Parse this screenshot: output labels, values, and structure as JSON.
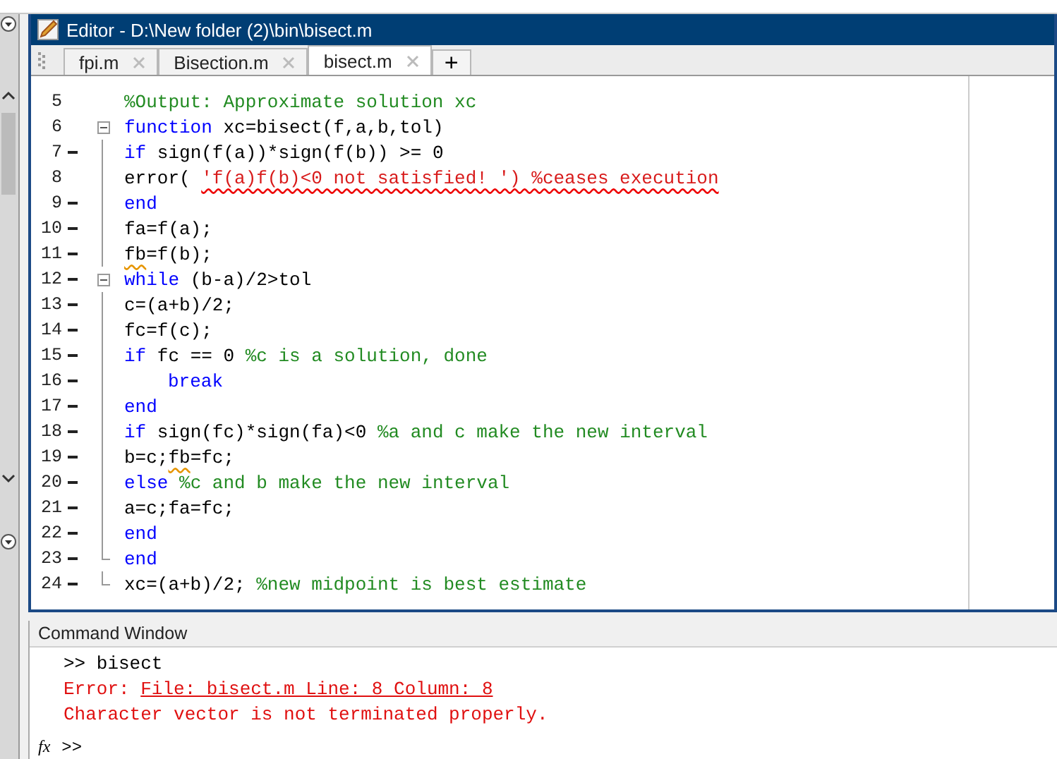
{
  "editor": {
    "title": "Editor - D:\\New folder (2)\\bin\\bisect.m",
    "tabs": [
      {
        "label": "fpi.m",
        "selected": false
      },
      {
        "label": "Bisection.m",
        "selected": false
      },
      {
        "label": "bisect.m",
        "selected": true
      }
    ],
    "new_tab": "+",
    "lines": [
      {
        "number": "5",
        "executable": false,
        "fold_start": false,
        "fold_end": false,
        "indented": false,
        "tokens": [
          {
            "text": "%Output: Approximate solution xc",
            "kind": "comment"
          }
        ]
      },
      {
        "number": "6",
        "executable": false,
        "fold_start": true,
        "fold_end": false,
        "indented": false,
        "tokens": [
          {
            "text": "function",
            "kind": "keyword"
          },
          {
            "text": " xc=bisect(f,a,b,tol)",
            "kind": "code"
          }
        ]
      },
      {
        "number": "7",
        "executable": true,
        "fold_start": false,
        "fold_end": false,
        "indented": false,
        "tokens": [
          {
            "text": "if",
            "kind": "keyword"
          },
          {
            "text": " sign(f(a))*sign(f(b)) >= 0",
            "kind": "code"
          }
        ]
      },
      {
        "number": "8",
        "executable": false,
        "fold_start": false,
        "fold_end": false,
        "indented": false,
        "tokens": [
          {
            "text": "error( ",
            "kind": "code"
          },
          {
            "text": "'f(a)f(b)<0 not satisfied! ') %ceases execution",
            "kind": "error"
          }
        ]
      },
      {
        "number": "9",
        "executable": true,
        "fold_start": false,
        "fold_end": false,
        "indented": false,
        "tokens": [
          {
            "text": "end",
            "kind": "keyword"
          }
        ]
      },
      {
        "number": "10",
        "executable": true,
        "fold_start": false,
        "fold_end": false,
        "indented": false,
        "tokens": [
          {
            "text": "fa=f(a);",
            "kind": "code"
          }
        ]
      },
      {
        "number": "11",
        "executable": true,
        "fold_start": false,
        "fold_end": false,
        "indented": false,
        "tokens": [
          {
            "text": "fb",
            "kind": "warning"
          },
          {
            "text": "=f(b);",
            "kind": "code"
          }
        ]
      },
      {
        "number": "12",
        "executable": true,
        "fold_start": true,
        "fold_end": false,
        "indented": false,
        "tokens": [
          {
            "text": "while",
            "kind": "keyword"
          },
          {
            "text": " (b-a)/2>tol",
            "kind": "code"
          }
        ]
      },
      {
        "number": "13",
        "executable": true,
        "fold_start": false,
        "fold_end": false,
        "indented": false,
        "tokens": [
          {
            "text": "c=(a+b)/2;",
            "kind": "code"
          }
        ]
      },
      {
        "number": "14",
        "executable": true,
        "fold_start": false,
        "fold_end": false,
        "indented": false,
        "tokens": [
          {
            "text": "fc=f(c);",
            "kind": "code"
          }
        ]
      },
      {
        "number": "15",
        "executable": true,
        "fold_start": false,
        "fold_end": false,
        "indented": false,
        "tokens": [
          {
            "text": "if",
            "kind": "keyword"
          },
          {
            "text": " fc == 0 ",
            "kind": "code"
          },
          {
            "text": "%c is a solution, done",
            "kind": "comment"
          }
        ]
      },
      {
        "number": "16",
        "executable": true,
        "fold_start": false,
        "fold_end": false,
        "indented": true,
        "tokens": [
          {
            "text": "break",
            "kind": "keyword"
          }
        ]
      },
      {
        "number": "17",
        "executable": true,
        "fold_start": false,
        "fold_end": false,
        "indented": false,
        "tokens": [
          {
            "text": "end",
            "kind": "keyword"
          }
        ]
      },
      {
        "number": "18",
        "executable": true,
        "fold_start": false,
        "fold_end": false,
        "indented": false,
        "tokens": [
          {
            "text": "if",
            "kind": "keyword"
          },
          {
            "text": " sign(fc)*sign(fa)<0 ",
            "kind": "code"
          },
          {
            "text": "%a and c make the new interval",
            "kind": "comment"
          }
        ]
      },
      {
        "number": "19",
        "executable": true,
        "fold_start": false,
        "fold_end": false,
        "indented": false,
        "tokens": [
          {
            "text": "b=c;",
            "kind": "code"
          },
          {
            "text": "fb",
            "kind": "warning"
          },
          {
            "text": "=fc;",
            "kind": "code"
          }
        ]
      },
      {
        "number": "20",
        "executable": true,
        "fold_start": false,
        "fold_end": false,
        "indented": false,
        "tokens": [
          {
            "text": "else",
            "kind": "keyword"
          },
          {
            "text": " %c and b make the new interval",
            "kind": "comment"
          }
        ]
      },
      {
        "number": "21",
        "executable": true,
        "fold_start": false,
        "fold_end": false,
        "indented": false,
        "tokens": [
          {
            "text": "a=c;fa=fc;",
            "kind": "code"
          }
        ]
      },
      {
        "number": "22",
        "executable": true,
        "fold_start": false,
        "fold_end": false,
        "indented": false,
        "tokens": [
          {
            "text": "end",
            "kind": "keyword"
          }
        ]
      },
      {
        "number": "23",
        "executable": true,
        "fold_start": false,
        "fold_end": true,
        "indented": false,
        "tokens": [
          {
            "text": "end",
            "kind": "keyword"
          }
        ]
      },
      {
        "number": "24",
        "executable": true,
        "fold_start": false,
        "fold_end": true,
        "indented": false,
        "tokens": [
          {
            "text": "xc=(a+b)/2; ",
            "kind": "code"
          },
          {
            "text": "%new midpoint is best estimate",
            "kind": "comment"
          }
        ]
      }
    ]
  },
  "command_window": {
    "title": "Command Window",
    "lines": [
      {
        "parts": [
          {
            "text": ">> bisect",
            "kind": "input"
          }
        ]
      },
      {
        "parts": [
          {
            "text": "Error: ",
            "kind": "error"
          },
          {
            "text": "File: bisect.m Line: 8 Column: 8",
            "kind": "link"
          }
        ]
      },
      {
        "parts": [
          {
            "text": "Character vector is not terminated properly.",
            "kind": "error"
          }
        ]
      }
    ],
    "fx": "fx",
    "prompt": ">>"
  }
}
